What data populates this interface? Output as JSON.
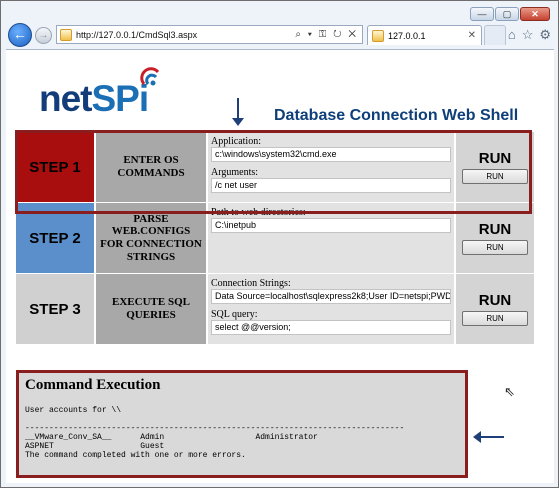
{
  "browser": {
    "url": "http://127.0.0.1/CmdSql3.aspx",
    "address_tools": "⌕ ▾ ⚿ ↻ ✕",
    "tab_title": "127.0.0.1",
    "window_controls": [
      "—",
      "▢",
      "✕"
    ]
  },
  "page": {
    "logo_text_a": "net",
    "logo_text_b": "SPi",
    "title": "Database Connection Web Shell"
  },
  "steps": [
    {
      "step_label": "STEP 1",
      "description": "ENTER OS COMMANDS",
      "fields": [
        {
          "label": "Application:",
          "value": "c:\\windows\\system32\\cmd.exe"
        },
        {
          "label": "Arguments:",
          "value": "/c net user"
        }
      ],
      "run_heading": "RUN",
      "run_button": "RUN"
    },
    {
      "step_label": "STEP 2",
      "description": "PARSE WEB.CONFIGS FOR CONNECTION STRINGS",
      "fields": [
        {
          "label": "Path to web directories:",
          "value": "C:\\inetpub"
        }
      ],
      "run_heading": "RUN",
      "run_button": "RUN"
    },
    {
      "step_label": "STEP 3",
      "description": "EXECUTE SQL QUERIES",
      "fields": [
        {
          "label": "Connection Strings:",
          "value": "Data Source=localhost\\sqlexpress2k8;User ID=netspi;PWD"
        },
        {
          "label": "SQL query:",
          "value": "select @@version;"
        }
      ],
      "run_heading": "RUN",
      "run_button": "RUN"
    }
  ],
  "output": {
    "title": "Command Execution",
    "text": "User accounts for \\\\\n\n-------------------------------------------------------------------------------\n__VMware_Conv_SA__      Admin                   Administrator\nASPNET                  Guest\nThe command completed with one or more errors."
  },
  "colors": {
    "step1": "#a80e0e",
    "step2": "#5b8fcc",
    "step3": "#d0d0d0",
    "highlight": "#8a1e1e",
    "title": "#0e3f7a"
  }
}
